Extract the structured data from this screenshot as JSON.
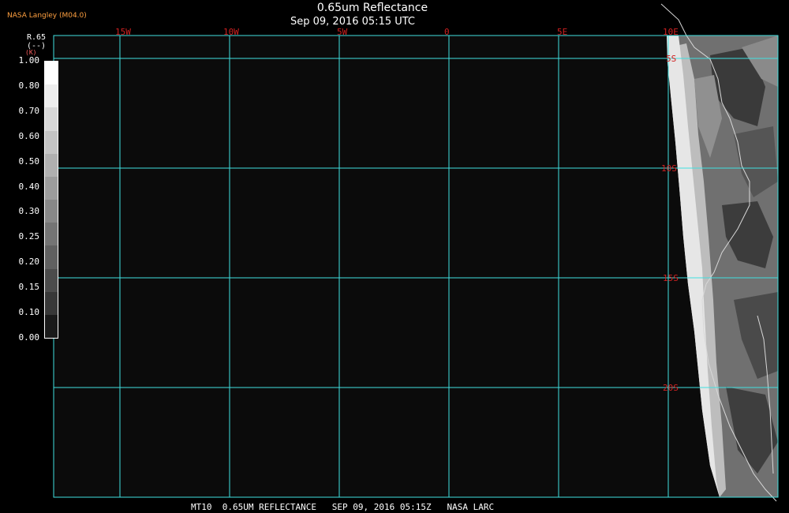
{
  "header": {
    "credit": "NASA Langley (M04.0)",
    "title": "0.65um Reflectance",
    "subtitle": "Sep 09, 2016 05:15 UTC"
  },
  "footer": {
    "text": "MT10  0.65UM REFLECTANCE   SEP 09, 2016 05:15Z   NASA LARC"
  },
  "legend": {
    "variable": "R.65",
    "unit": "(--)",
    "k": "(K)",
    "ticks": [
      "1.00",
      "0.80",
      "0.70",
      "0.60",
      "0.50",
      "0.40",
      "0.30",
      "0.25",
      "0.20",
      "0.15",
      "0.10",
      "0.00"
    ],
    "colors": [
      "#ffffff",
      "#eeeeee",
      "#d8d8d8",
      "#c4c4c4",
      "#b0b0b0",
      "#9c9c9c",
      "#888888",
      "#747474",
      "#606060",
      "#4c4c4c",
      "#383838",
      "#1a1a1a"
    ]
  },
  "map": {
    "gridline_color": "#40e0e0",
    "label_color": "#d02020",
    "coast_color": "#d0d0d0",
    "ocean_color": "#0b0b0b",
    "longitude_labels": [
      "15W",
      "10W",
      "5W",
      "0",
      "5E",
      "10E"
    ],
    "latitude_labels": [
      "5S",
      "10S",
      "15S",
      "20S"
    ]
  }
}
